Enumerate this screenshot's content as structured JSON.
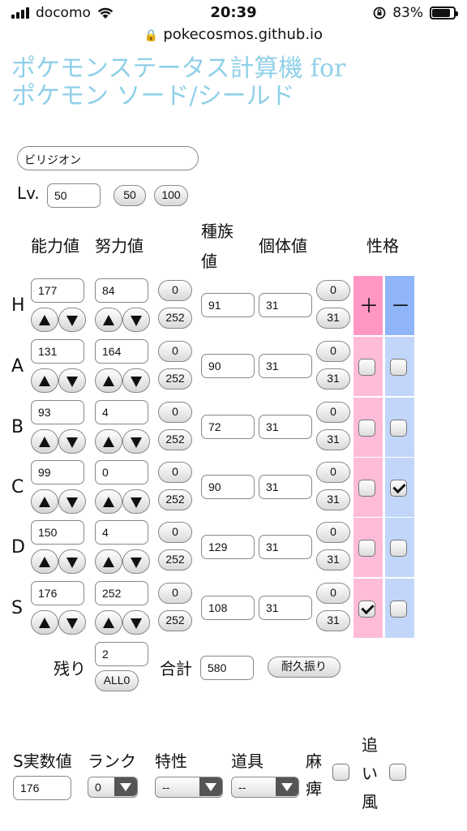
{
  "status_bar": {
    "carrier": "docomo",
    "time": "20:39",
    "battery": "83%"
  },
  "browser": {
    "url": "pokecosmos.github.io"
  },
  "app": {
    "title_line1": "ポケモンステータス計算機 for",
    "title_line2": "ポケモン ソード/シールド"
  },
  "pokemon": {
    "name": "ビリジオン"
  },
  "level": {
    "label": "Lv.",
    "value": "50",
    "preset_50": "50",
    "preset_100": "100"
  },
  "headers": {
    "stat": "能力値",
    "ev": "努力値",
    "base_line1": "種族",
    "base_line2": "値",
    "iv": "個体値",
    "nature": "性格"
  },
  "nature_signs": {
    "plus": "＋",
    "minus": "－"
  },
  "ev_button_min": "0",
  "ev_button_max": "252",
  "iv_button_min": "0",
  "iv_button_max": "31",
  "stats": [
    {
      "key": "H",
      "stat": "177",
      "ev": "84",
      "base": "91",
      "iv": "31",
      "plus": null,
      "minus": null
    },
    {
      "key": "A",
      "stat": "131",
      "ev": "164",
      "base": "90",
      "iv": "31",
      "plus": false,
      "minus": false
    },
    {
      "key": "B",
      "stat": "93",
      "ev": "4",
      "base": "72",
      "iv": "31",
      "plus": false,
      "minus": false
    },
    {
      "key": "C",
      "stat": "99",
      "ev": "0",
      "base": "90",
      "iv": "31",
      "plus": false,
      "minus": true
    },
    {
      "key": "D",
      "stat": "150",
      "ev": "4",
      "base": "129",
      "iv": "31",
      "plus": false,
      "minus": false
    },
    {
      "key": "S",
      "stat": "176",
      "ev": "252",
      "base": "108",
      "iv": "31",
      "plus": true,
      "minus": false
    }
  ],
  "remaining": {
    "label": "残り",
    "value": "2",
    "all0": "ALL0"
  },
  "total": {
    "label": "合計",
    "value": "580",
    "bulk_button": "耐久振り"
  },
  "speed": {
    "label": "S実数値",
    "value": "176",
    "rank_label": "ランク",
    "rank_value": "0",
    "ability_label": "特性",
    "ability_value": "--",
    "item_label": "道具",
    "item_value": "--",
    "paralysis_label_1": "麻",
    "paralysis_label_2": "痺",
    "tailwind_label_1": "追",
    "tailwind_label_2": "い",
    "tailwind_label_3": "風"
  },
  "colors": {
    "title": "#8fd0e8",
    "plus_bg": "#ffbcd8",
    "minus_bg": "#c2d6fa",
    "plus_header": "#ff97c4",
    "minus_header": "#8fb4f7"
  }
}
